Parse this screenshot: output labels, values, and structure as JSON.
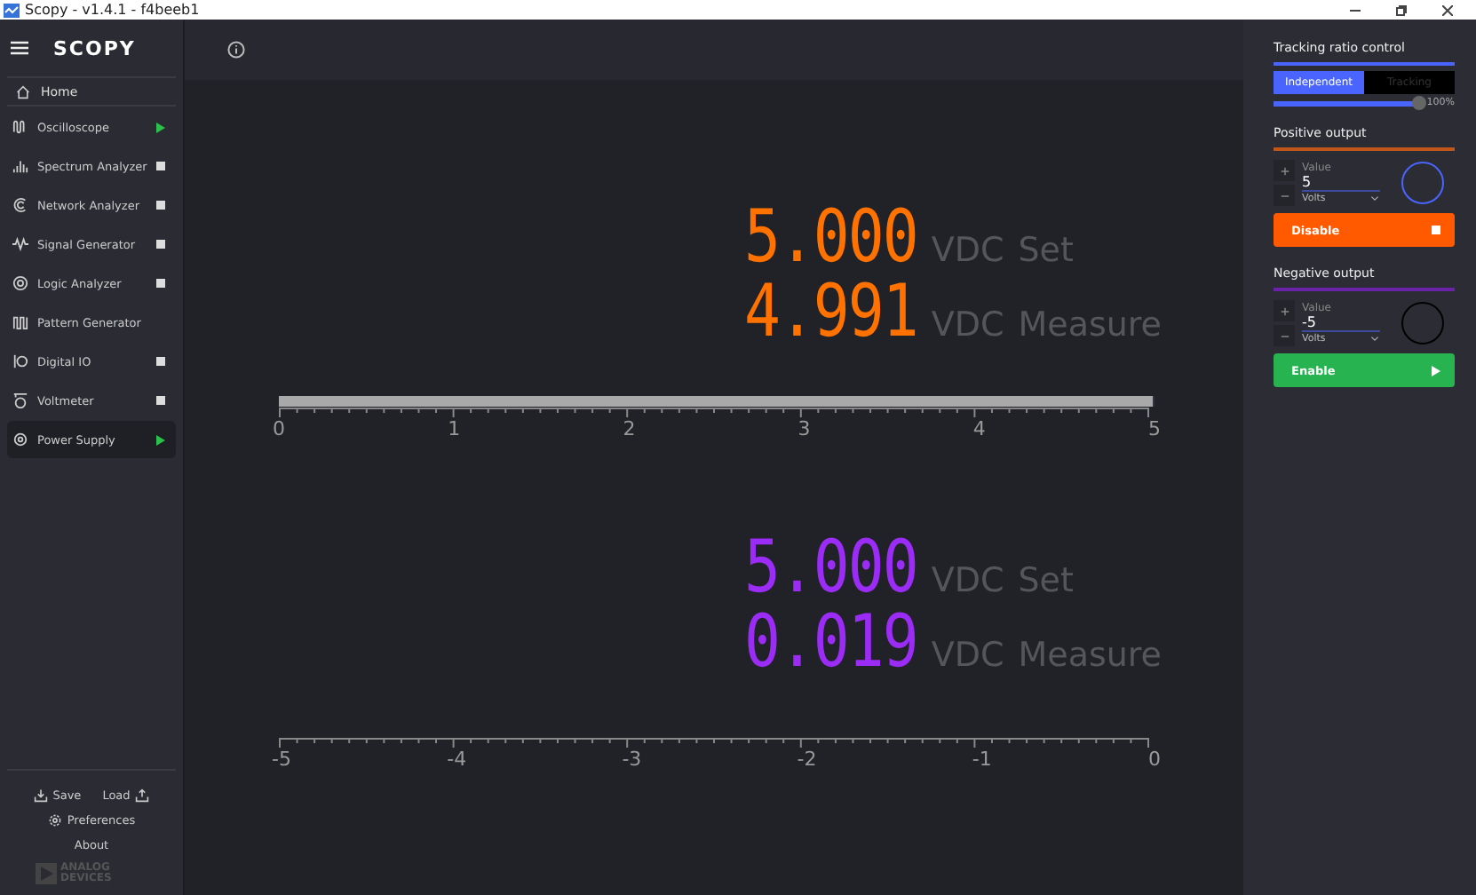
{
  "window": {
    "title": "Scopy - v1.4.1 - f4beeb1"
  },
  "sidebar": {
    "logo": "SCOPY",
    "home": "Home",
    "items": [
      {
        "label": "Oscilloscope",
        "kind": "running",
        "selected": false
      },
      {
        "label": "Spectrum Analyzer",
        "kind": "stopped",
        "selected": false
      },
      {
        "label": "Network Analyzer",
        "kind": "stopped",
        "selected": false
      },
      {
        "label": "Signal Generator",
        "kind": "stopped",
        "selected": false
      },
      {
        "label": "Logic Analyzer",
        "kind": "stopped",
        "selected": false
      },
      {
        "label": "Pattern Generator",
        "kind": "idle",
        "selected": false
      },
      {
        "label": "Digital IO",
        "kind": "stopped",
        "selected": false
      },
      {
        "label": "Voltmeter",
        "kind": "stopped",
        "selected": false
      },
      {
        "label": "Power Supply",
        "kind": "running",
        "selected": true
      }
    ],
    "save": "Save",
    "load": "Load",
    "preferences": "Preferences",
    "about": "About",
    "brand": [
      "ANALOG",
      "DEVICES"
    ]
  },
  "channels": [
    {
      "color": "#ff7200",
      "set_value": "5.000",
      "measured_value": "4.991",
      "set_unit": "VDC",
      "measure_unit": "VDC",
      "set_label": "Set",
      "measure_label": "Measure",
      "level": 0.998,
      "ticks": [
        "0",
        "1",
        "2",
        "3",
        "4",
        "5"
      ]
    },
    {
      "color": "#9b2cf5",
      "set_value": "5.000",
      "measured_value": "0.019",
      "set_unit": "VDC",
      "measure_unit": "VDC",
      "set_label": "Set",
      "measure_label": "Measure",
      "ticks": [
        "-5",
        "-4",
        "-3",
        "-2",
        "-1",
        "0"
      ]
    }
  ],
  "tracking": {
    "title": "Tracking ratio control",
    "modes": [
      {
        "label": "Independent",
        "selected": true
      },
      {
        "label": "Tracking",
        "selected": false
      }
    ],
    "level": 1,
    "reading": "100%"
  },
  "outputs": [
    {
      "title": "Positive output",
      "color": "#c0571a",
      "value_label": "Value",
      "value": "5",
      "unit": "Volts",
      "focused": true,
      "button": {
        "label": "Disable",
        "kind": "stop"
      }
    },
    {
      "title": "Negative output",
      "color": "#6a23a8",
      "value_label": "Value",
      "value": "-5",
      "unit": "Volts",
      "focused": false,
      "button": {
        "label": "Enable",
        "kind": "run"
      }
    }
  ]
}
